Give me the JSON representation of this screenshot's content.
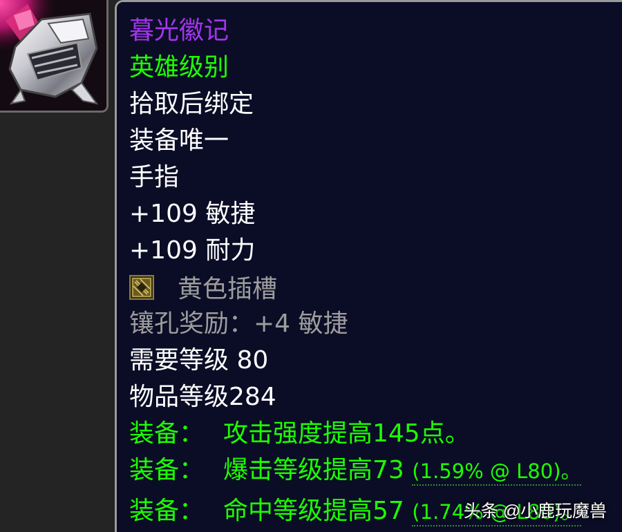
{
  "item": {
    "icon": "ring-icon",
    "name": "暮光徽记",
    "quality": "英雄级别",
    "bind": "拾取后绑定",
    "unique": "装备唯一",
    "slot": "手指",
    "stats": [
      "+109 敏捷",
      "+109 耐力"
    ],
    "socket": {
      "icon": "yellow-socket-icon",
      "label": "黄色插槽"
    },
    "socket_bonus": "镶孔奖励：+4 敏捷",
    "required_level": "需要等级 80",
    "item_level": "物品等级284",
    "equip_effects": [
      {
        "label": "装备：",
        "text": "攻击强度提高145点。",
        "detail": ""
      },
      {
        "label": "装备：",
        "text": "爆击等级提高73",
        "detail": "(1.59% @ L80)。"
      },
      {
        "label": "装备：",
        "text": "命中等级提高57",
        "detail": "(1.74% @ L80)。"
      }
    ]
  },
  "watermark": "头条 @小鹿玩魔兽",
  "colors": {
    "epic": "#a335ee",
    "uncommon": "#1eff00",
    "white": "#ffffff",
    "gray": "#9d9d9d",
    "tooltip_bg": "#0b0d26"
  }
}
